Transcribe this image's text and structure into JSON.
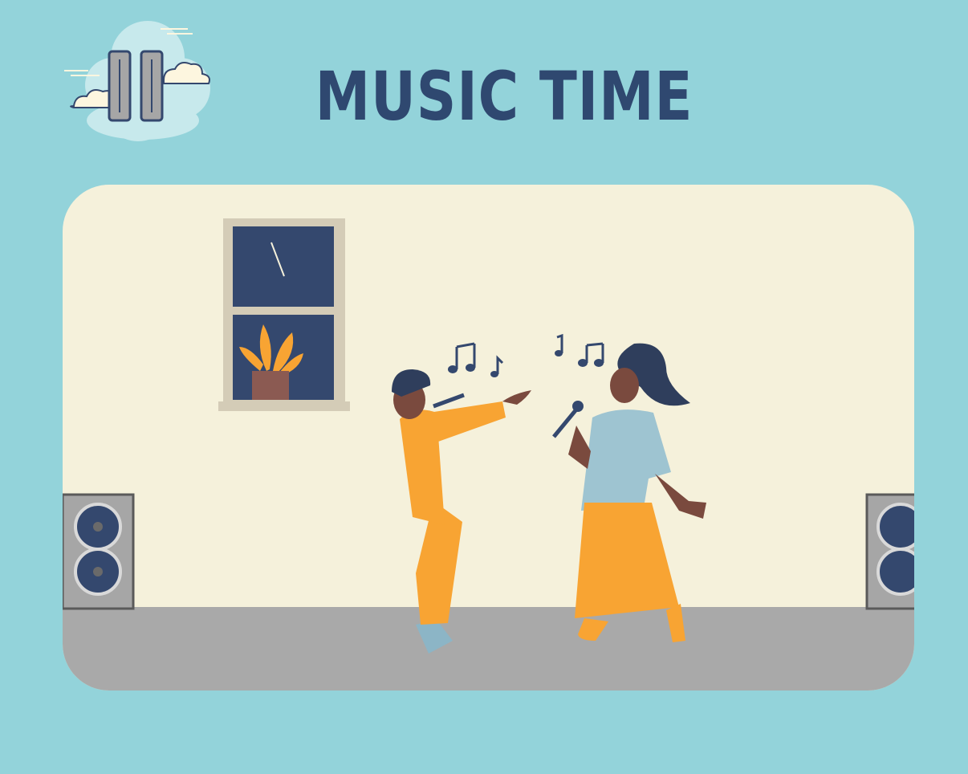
{
  "title": "MUSIC TIME",
  "icons": {
    "pause": "pause-icon",
    "cloud": "cloud-icon",
    "window": "window-icon",
    "plant": "plant-icon",
    "speaker": "speaker-icon",
    "music_note": "music-note-icon"
  },
  "colors": {
    "background": "#93d3da",
    "title": "#2f4870",
    "wall": "#f5f1db",
    "floor": "#a9a9a9",
    "accent_orange": "#f8a433",
    "navy": "#34486e"
  }
}
